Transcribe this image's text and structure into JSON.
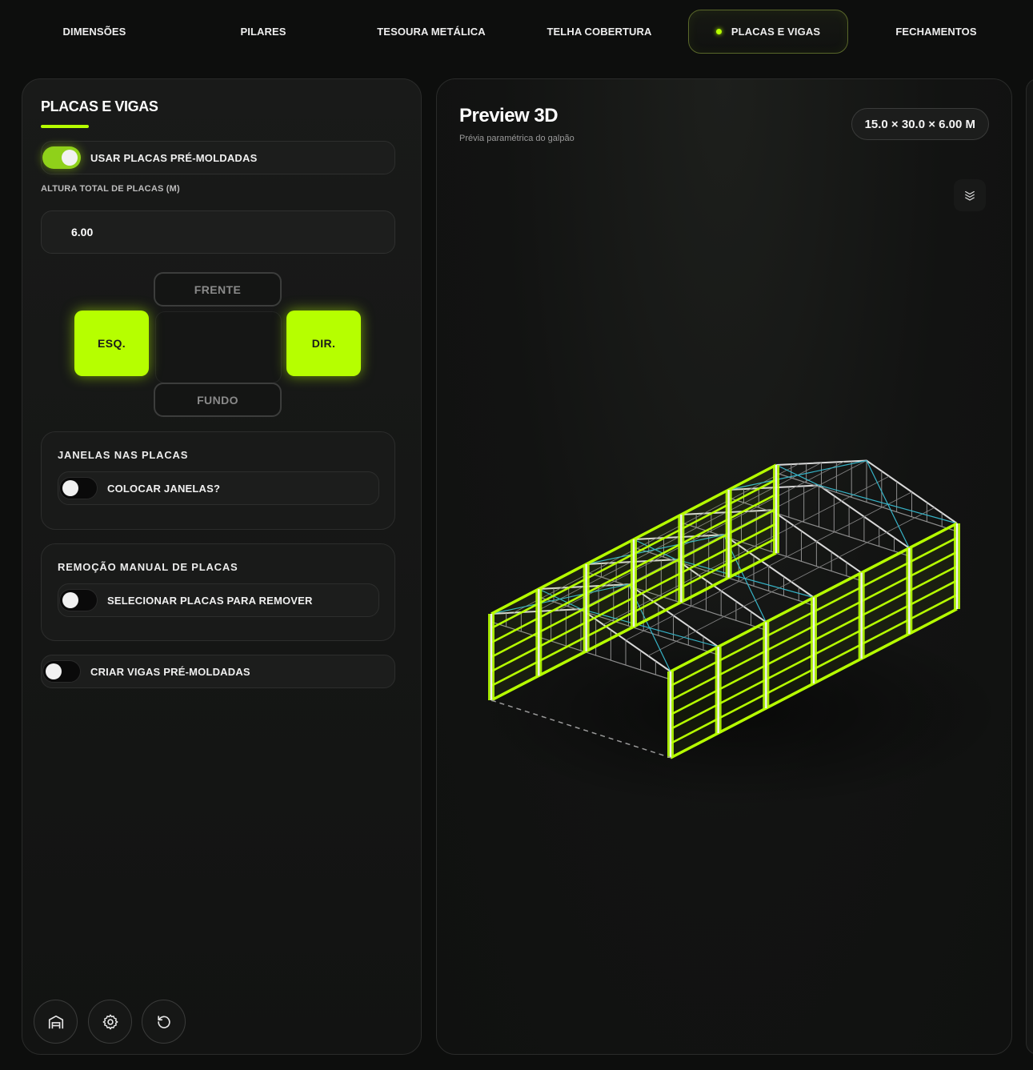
{
  "tabs": [
    {
      "label": "DIMENSÕES"
    },
    {
      "label": "PILARES"
    },
    {
      "label": "TESOURA METÁLICA"
    },
    {
      "label": "TELHA COBERTURA"
    },
    {
      "label": "PLACAS E VIGAS",
      "active": true
    },
    {
      "label": "FECHAMENTOS"
    }
  ],
  "panel": {
    "title": "PLACAS E VIGAS",
    "use_precast": {
      "label": "USAR PLACAS PRÉ-MOLDADAS",
      "on": true
    },
    "height_label": "ALTURA TOTAL DE PLACAS (M)",
    "height_value": "6.00",
    "sides": {
      "front": "FRENTE",
      "left": "ESQ.",
      "right": "DIR.",
      "back": "FUNDO"
    },
    "windows": {
      "title": "JANELAS NAS PLACAS",
      "toggle_label": "COLOCAR JANELAS?",
      "on": false
    },
    "removal": {
      "title": "REMOÇÃO MANUAL DE PLACAS",
      "toggle_label": "SELECIONAR PLACAS PARA REMOVER",
      "on": false
    },
    "beams": {
      "label": "CRIAR VIGAS PRÉ-MOLDADAS",
      "on": false
    }
  },
  "bottom_icons": [
    "warehouse-icon",
    "gear-icon",
    "reset-icon"
  ],
  "preview": {
    "title": "Preview 3D",
    "subtitle": "Prévia paramétrica do galpão",
    "dims": "15.0 × 30.0 × 6.00 M"
  },
  "colors": {
    "accent": "#b6ff00",
    "panel_bg": "#191a19",
    "page_bg": "#0d0e0d",
    "brace": "#36b4c8"
  }
}
